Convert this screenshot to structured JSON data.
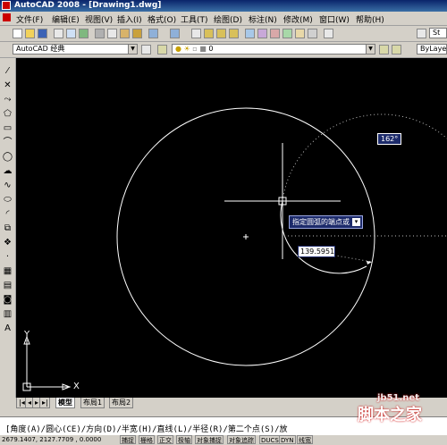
{
  "window": {
    "title": "AutoCAD 2008 - [Drawing1.dwg]"
  },
  "menu": {
    "items": [
      "文件(F)",
      "编辑(E)",
      "视图(V)",
      "插入(I)",
      "格式(O)",
      "工具(T)",
      "绘图(D)",
      "标注(N)",
      "修改(M)",
      "窗口(W)",
      "帮助(H)"
    ]
  },
  "toolbar2": {
    "workspace": "AutoCAD 经典",
    "layer": "0",
    "color": "ByLayer",
    "style_label": "St"
  },
  "canvas": {
    "angle_value": "162°",
    "prompt": "指定圆弧的端点或",
    "length_value": "139.5951",
    "ucs_x": "X",
    "ucs_y": "Y",
    "colors": {
      "background": "#000000",
      "geometry": "#ffffff",
      "tooltip": "#1d2b6b"
    }
  },
  "tabs": {
    "model": "模型",
    "layout1": "布局1",
    "layout2": "布局2"
  },
  "command": {
    "text": "[角度(A)/圆心(CE)/方向(D)/半宽(H)/直线(L)/半径(R)/第二个点(S)/放"
  },
  "status": {
    "coords": "2679.1407, 2127.7709 , 0.0000",
    "buttons": [
      "捕捉",
      "栅格",
      "正交",
      "极轴",
      "对象捕捉",
      "对象追踪",
      "DUCS",
      "DYN",
      "线宽"
    ]
  },
  "watermark": {
    "text": "脚本之家",
    "site": "jb51.net"
  }
}
